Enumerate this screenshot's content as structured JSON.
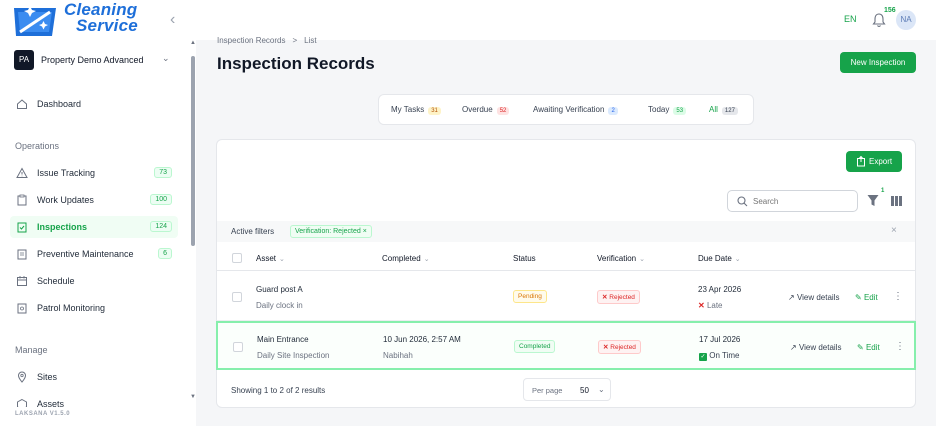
{
  "app": {
    "logo_line1": "Cleaning",
    "logo_line2": "Service",
    "version": "LAKSANA V1.5.0",
    "language": "EN",
    "notification_count": "156",
    "user_initials": "NA"
  },
  "sidebar": {
    "property": {
      "initials": "PA",
      "name": "Property Demo Advanced"
    },
    "dashboard": "Dashboard",
    "operations_label": "Operations",
    "operations": [
      {
        "label": "Issue Tracking",
        "count": "73"
      },
      {
        "label": "Work Updates",
        "count": "100"
      },
      {
        "label": "Inspections",
        "count": "124"
      },
      {
        "label": "Preventive Maintenance",
        "count": "6"
      },
      {
        "label": "Schedule"
      },
      {
        "label": "Patrol Monitoring"
      }
    ],
    "manage_label": "Manage",
    "manage": [
      {
        "label": "Sites"
      },
      {
        "label": "Assets"
      }
    ]
  },
  "breadcrumb": [
    "Inspection Records",
    "List"
  ],
  "page": {
    "title": "Inspection Records",
    "new_button": "New Inspection"
  },
  "tabs": [
    {
      "label": "My Tasks",
      "count": "31"
    },
    {
      "label": "Overdue",
      "count": "52"
    },
    {
      "label": "Awaiting Verification",
      "count": "2"
    },
    {
      "label": "Today",
      "count": "53"
    },
    {
      "label": "All",
      "count": "127"
    }
  ],
  "toolbar": {
    "export": "Export",
    "search_placeholder": "Search",
    "filter_count": "1"
  },
  "filters": {
    "label": "Active filters",
    "chips": [
      "Verification: Rejected"
    ]
  },
  "table": {
    "columns": [
      "Asset",
      "Completed",
      "Status",
      "Verification",
      "Due Date"
    ],
    "rows": [
      {
        "asset": "Guard post A",
        "asset_sub": "Daily clock in",
        "completed": "",
        "completed_by": "",
        "status": "Pending",
        "verification": "Rejected",
        "due": "23 Apr 2026",
        "due_state": "Late",
        "view": "View details",
        "edit": "Edit"
      },
      {
        "asset": "Main Entrance",
        "asset_sub": "Daily Site Inspection",
        "completed": "10 Jun 2026, 2:57 AM",
        "completed_by": "Nabihah",
        "status": "Completed",
        "verification": "Rejected",
        "due": "17 Jul 2026",
        "due_state": "On Time",
        "view": "View details",
        "edit": "Edit"
      }
    ]
  },
  "pagination": {
    "summary": "Showing 1 to 2 of 2 results",
    "per_page_label": "Per page",
    "per_page_value": "50"
  },
  "colors": {
    "accent": "#16a34a",
    "brand_blue": "#1e6fd9",
    "danger": "#dc2626",
    "warning": "#d97706"
  },
  "icons": [
    "logo-mark",
    "chevron-left-icon",
    "bell-icon",
    "home-icon",
    "warning-icon",
    "clipboard-icon",
    "clipboard-check-icon",
    "calendar-icon",
    "shield-icon",
    "map-pin-icon",
    "search-icon",
    "filter-icon",
    "columns-icon",
    "close-icon",
    "x-mark-icon",
    "check-square-icon",
    "external-link-icon",
    "edit-icon",
    "kebab-icon"
  ]
}
